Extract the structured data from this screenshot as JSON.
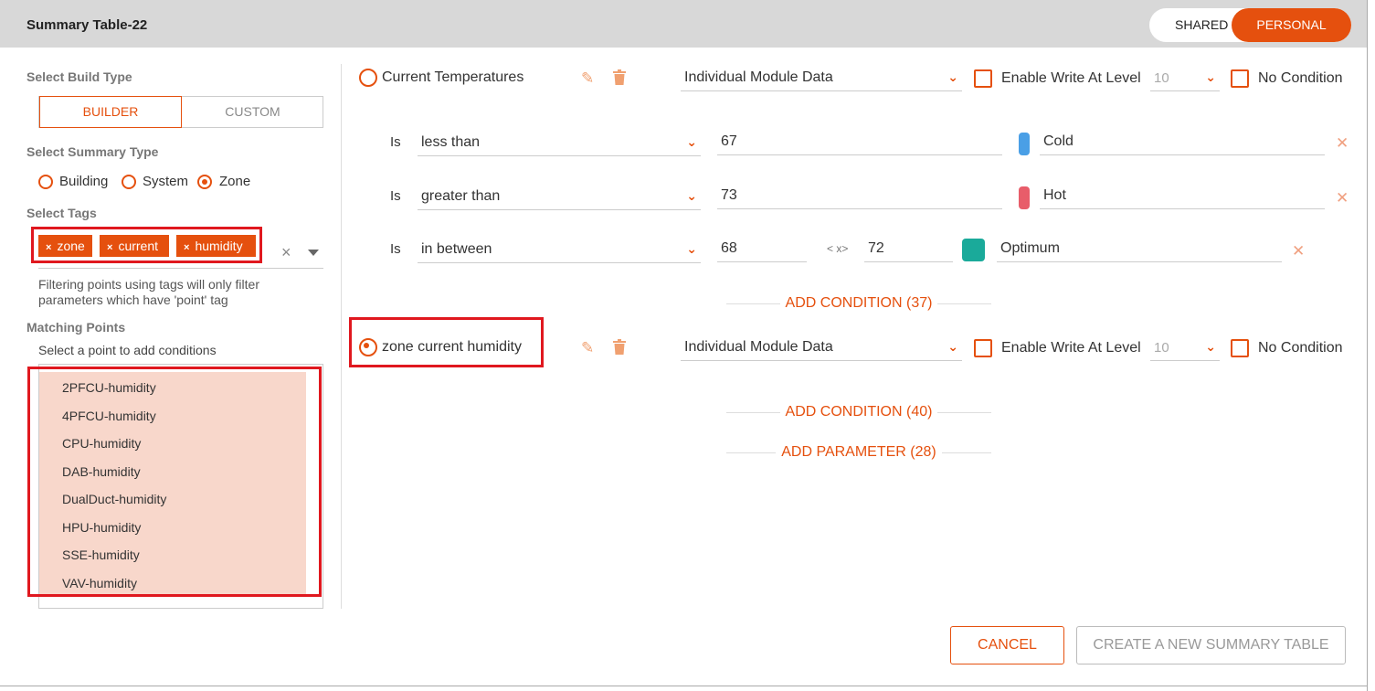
{
  "header": {
    "title": "Summary Table-22",
    "toggle_shared": "SHARED",
    "toggle_personal": "PERSONAL"
  },
  "left": {
    "build_type_label": "Select Build Type",
    "build_builder": "BUILDER",
    "build_custom": "CUSTOM",
    "summary_type_label": "Select Summary Type",
    "summary_types": [
      "Building",
      "System",
      "Zone"
    ],
    "summary_selected": "Zone",
    "tags_label": "Select Tags",
    "tags": [
      "zone",
      "current",
      "humidity"
    ],
    "tag_remove_glyph": "×",
    "tags_clear_glyph": "×",
    "help_text": "Filtering points using tags will only filter parameters which have 'point' tag",
    "matching_points_label": "Matching Points",
    "select_point_hint": "Select a point to add conditions",
    "points": [
      "2PFCU-humidity",
      "4PFCU-humidity",
      "CPU-humidity",
      "DAB-humidity",
      "DualDuct-humidity",
      "HPU-humidity",
      "SSE-humidity",
      "VAV-humidity"
    ]
  },
  "params": [
    {
      "label": "Current Temperatures",
      "selected": false,
      "data_source": "Individual Module Data",
      "enable_write_label": "Enable Write At Level",
      "level": "10",
      "no_condition_label": "No Condition",
      "conditions": [
        {
          "is": "Is",
          "op": "less than",
          "value": "67",
          "label": "Cold",
          "color": "#4a9fe6"
        },
        {
          "is": "Is",
          "op": "greater than",
          "value": "73",
          "label": "Hot",
          "color": "#e85d6a"
        },
        {
          "is": "Is",
          "op": "in between",
          "value": "68",
          "between": "< x>",
          "value2": "72",
          "label": "Optimum",
          "color": "#1aaa9a"
        }
      ],
      "add_condition": "ADD CONDITION (37)"
    },
    {
      "label": "zone current humidity",
      "selected": true,
      "data_source": "Individual Module Data",
      "enable_write_label": "Enable Write At Level",
      "level": "10",
      "no_condition_label": "No Condition",
      "conditions": [],
      "add_condition": "ADD CONDITION (40)"
    }
  ],
  "add_parameter": "ADD PARAMETER (28)",
  "footer": {
    "cancel": "CANCEL",
    "create": "CREATE A NEW SUMMARY TABLE"
  },
  "icons": {
    "edit": "pencil-icon",
    "delete": "trash-icon",
    "dropdown": "chevron-down-icon",
    "remove": "close-icon"
  },
  "colors": {
    "accent": "#e5500e",
    "highlight": "#e0181f",
    "point_bg": "#f8d7cb"
  }
}
